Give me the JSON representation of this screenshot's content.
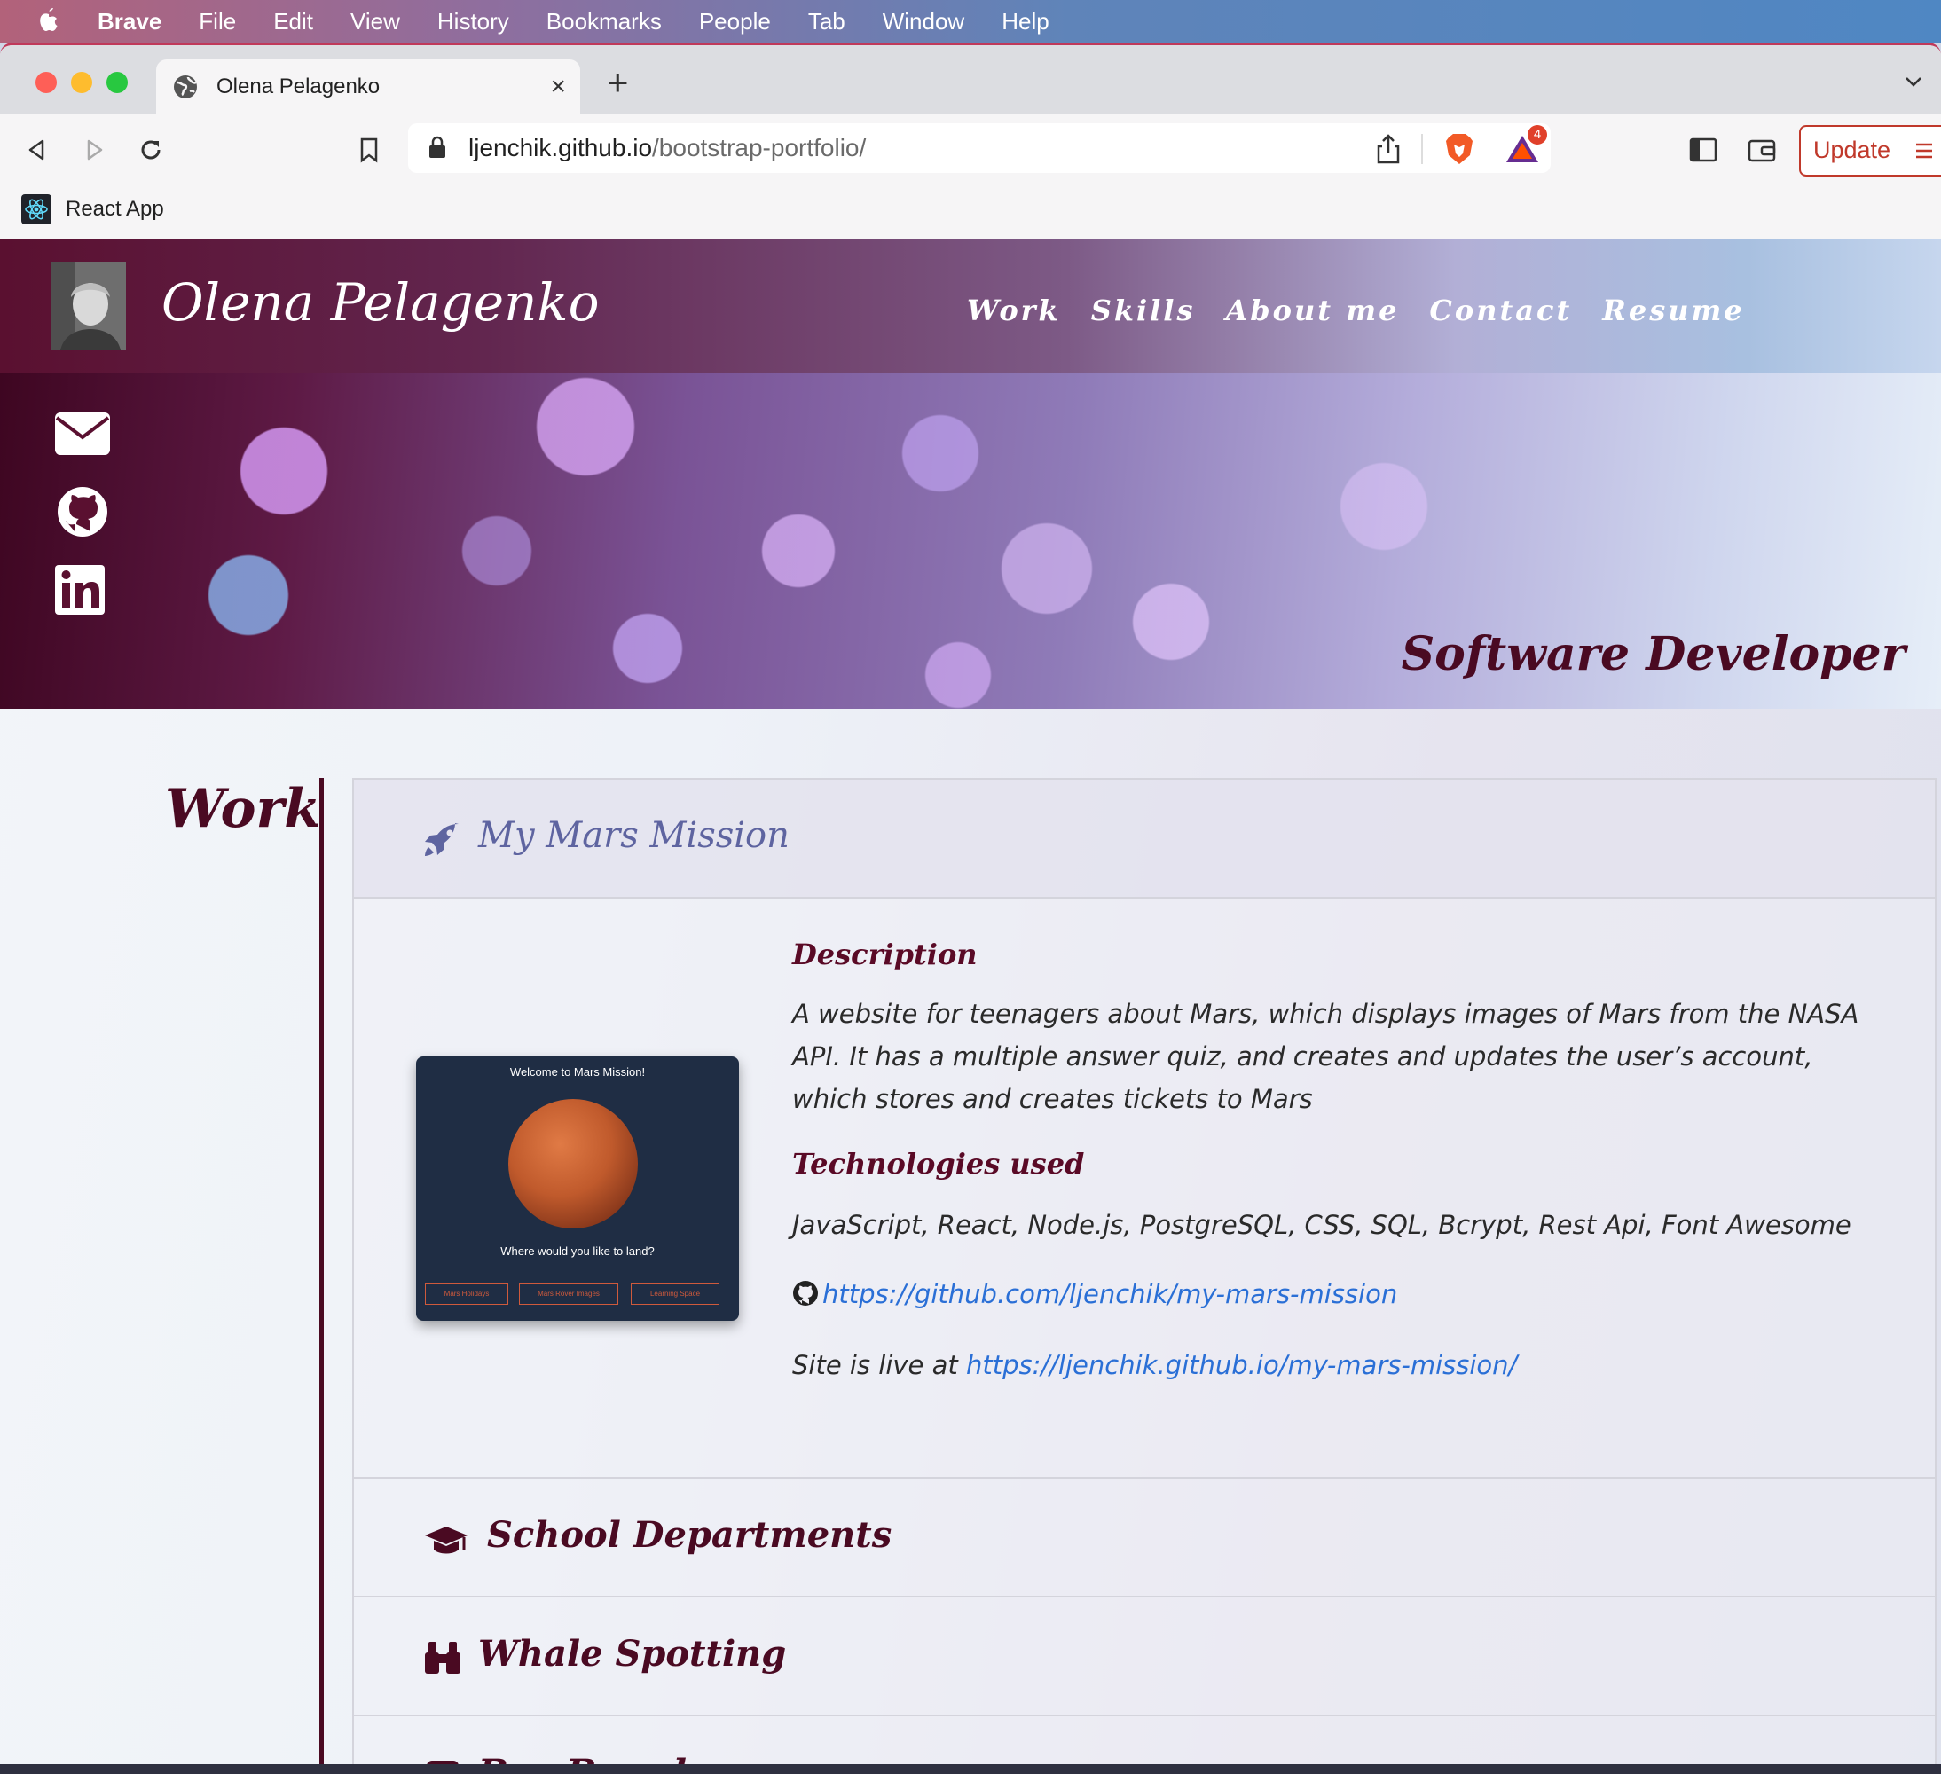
{
  "menubar": {
    "app": "Brave",
    "items": [
      "File",
      "Edit",
      "View",
      "History",
      "Bookmarks",
      "People",
      "Tab",
      "Window",
      "Help"
    ]
  },
  "browser": {
    "tab_title": "Olena Pelagenko",
    "new_tab_symbol": "+",
    "tab_close_symbol": "×",
    "url_host": "ljenchik.github.io",
    "url_path": "/bootstrap-portfolio/",
    "shields_badge": "4",
    "update_label": "Update",
    "bookmark_label": "React App"
  },
  "site": {
    "brand": "Olena Pelagenko",
    "nav": [
      "Work",
      "Skills",
      "About me",
      "Contact",
      "Resume"
    ],
    "tagline": "Software Developer",
    "social_icons": [
      "envelope-icon",
      "github-icon",
      "linkedin-icon"
    ],
    "section_title": "Work",
    "projects": [
      {
        "title": "My Mars Mission",
        "icon": "rocket-icon",
        "open": true
      },
      {
        "title": "School Departments",
        "icon": "graduation-cap-icon",
        "open": false
      },
      {
        "title": "Whale Spotting",
        "icon": "binoculars-icon",
        "open": false
      },
      {
        "title": "Bus Board",
        "icon": "bus-icon",
        "open": false
      }
    ],
    "project_detail": {
      "description_heading": "Description",
      "description": "A website for teenagers about Mars, which displays images of Mars from the NASA API. It has a multiple answer quiz, and creates and updates the user’s account, which stores and creates tickets to Mars",
      "tech_heading": "Technologies used",
      "technologies": "JavaScript, React, Node.js, PostgreSQL, CSS, SQL, Bcrypt, Rest Api, Font Awesome",
      "github_url": "https://github.com/ljenchik/my-mars-mission",
      "live_prefix": "Site is live at ",
      "live_url": "https://ljenchik.github.io/my-mars-mission/",
      "screenshot": {
        "title": "Welcome to Mars Mission!",
        "question": "Where would you like to land?",
        "buttons": [
          "Mars Holidays",
          "Mars Rover Images",
          "Learning Space"
        ]
      }
    }
  },
  "colors": {
    "accent_dark": "#4a0a22",
    "link": "#2a6fd6",
    "open_title": "#5e64a0"
  }
}
